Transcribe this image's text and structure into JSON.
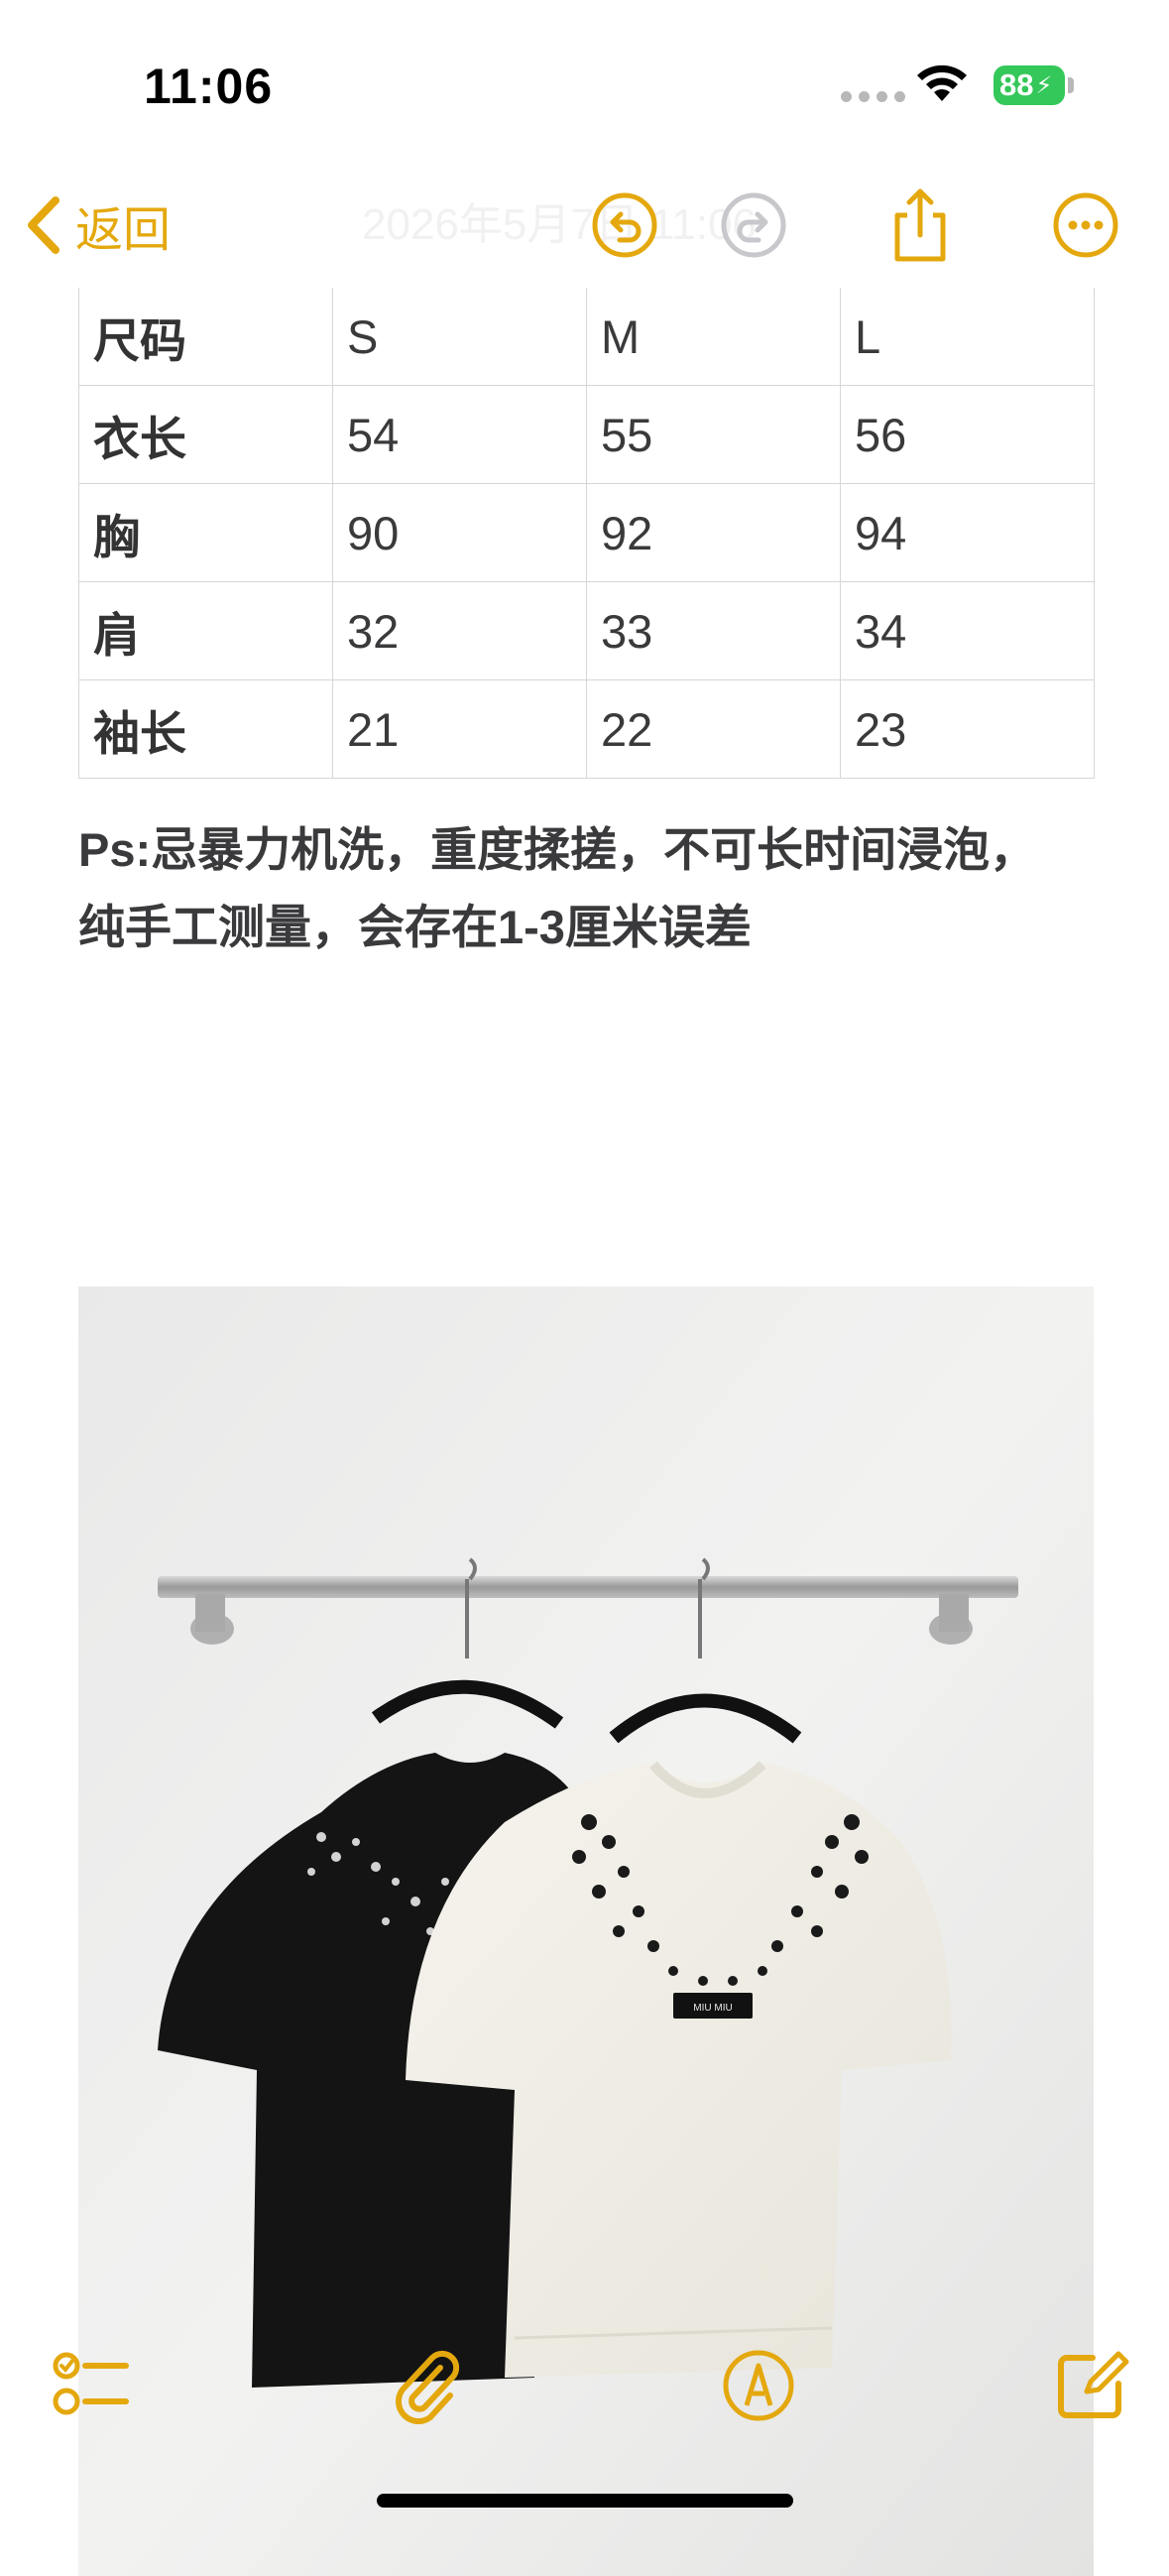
{
  "status_bar": {
    "time": "11:06",
    "battery_level": "88"
  },
  "nav": {
    "back_label": "返回",
    "title_faded": "2026年5月7日 11:06",
    "accent_color": "#e4a80e"
  },
  "size_table": {
    "header": [
      "尺码",
      "S",
      "M",
      "L"
    ],
    "rows": [
      [
        "衣长",
        "54",
        "55",
        "56"
      ],
      [
        "胸",
        "90",
        "92",
        "94"
      ],
      [
        "肩",
        "32",
        "33",
        "34"
      ],
      [
        "袖长",
        "21",
        "22",
        "23"
      ]
    ]
  },
  "note": {
    "line1": "Ps:忌暴力机洗，重度揉搓，不可长时间浸泡，",
    "line2": "纯手工测量，会存在1-3厘米误差"
  },
  "photo": {
    "label_text": "MIU MIU"
  },
  "toolbar": {
    "icons": [
      "checklist-icon",
      "paperclip-icon",
      "markup-pen-icon",
      "compose-icon"
    ]
  }
}
